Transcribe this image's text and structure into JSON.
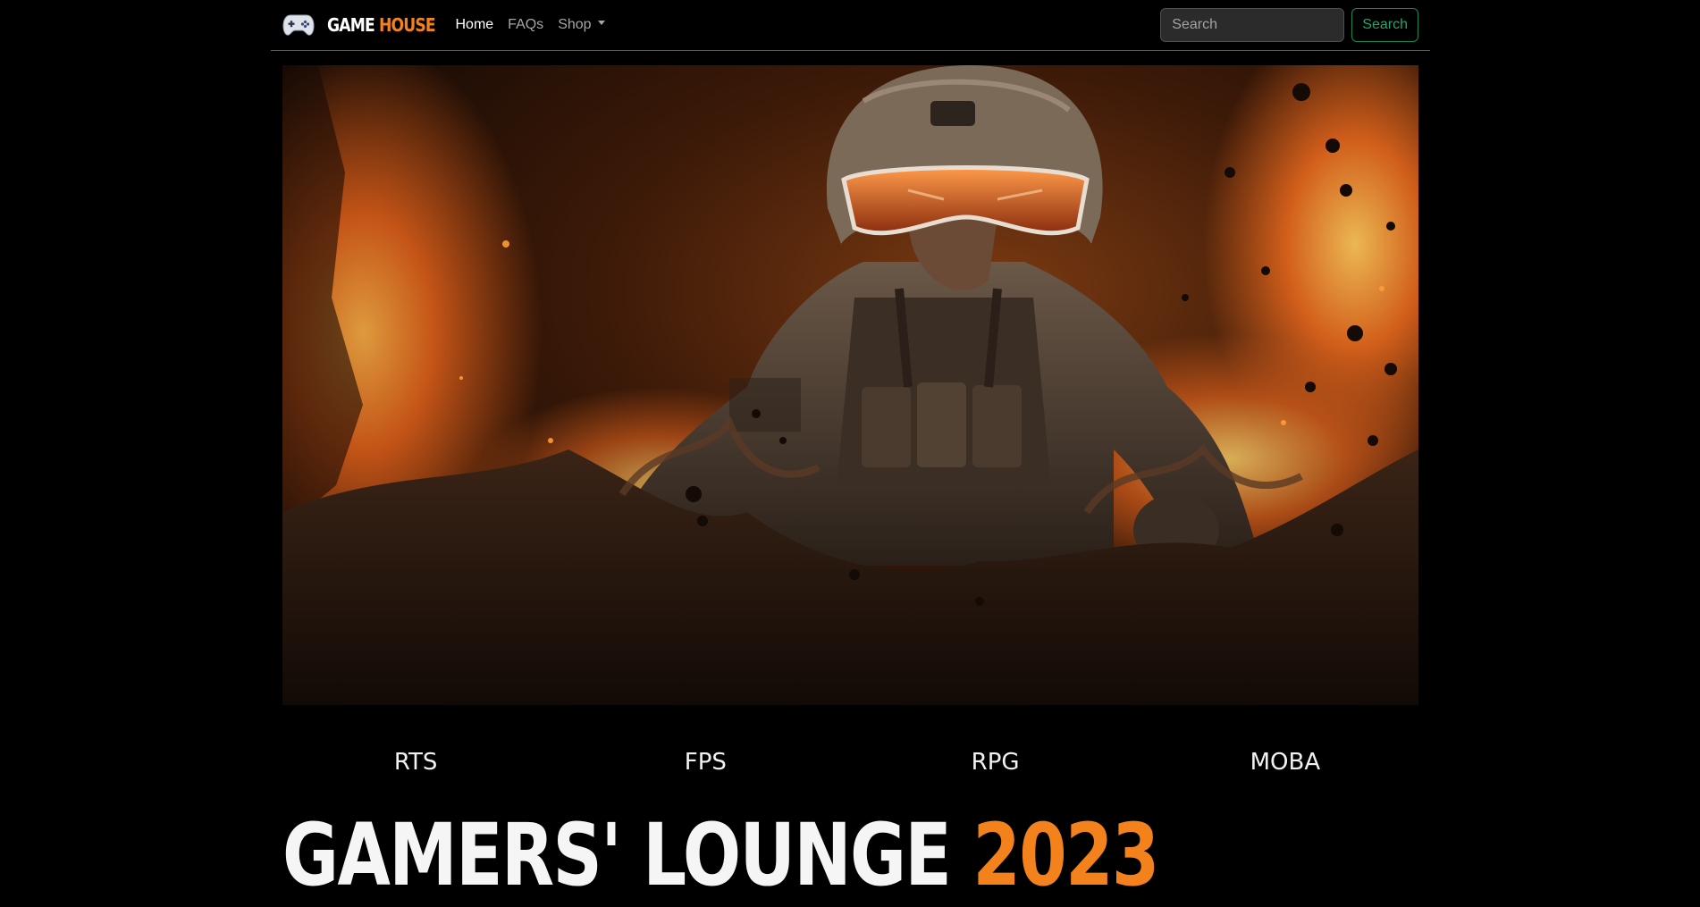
{
  "navbar": {
    "brand": {
      "icon": "gamepad-icon",
      "text_main": "GAME",
      "text_accent": "HOUSE"
    },
    "links": [
      {
        "label": "Home",
        "active": true
      },
      {
        "label": "FAQs",
        "active": false
      },
      {
        "label": "Shop",
        "active": false,
        "dropdown": true
      }
    ],
    "search": {
      "placeholder": "Search",
      "button_label": "Search"
    }
  },
  "hero": {
    "image": "soldier-in-explosion-image"
  },
  "genres": [
    "RTS",
    "FPS",
    "RPG",
    "MOBA"
  ],
  "headline": {
    "text_main": "GAMERS' LOUNGE",
    "text_accent": "2023"
  },
  "colors": {
    "background": "#000000",
    "accent": "#f3821c",
    "search_button": "#198754"
  }
}
